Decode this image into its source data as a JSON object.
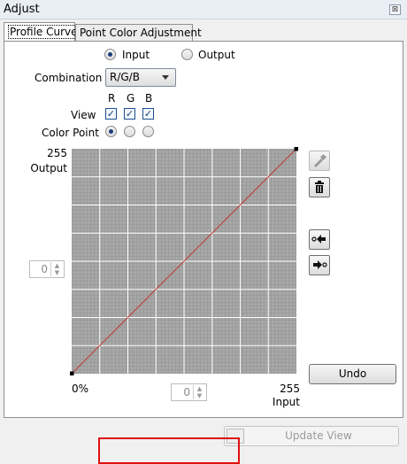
{
  "window": {
    "title": "Adjust",
    "close_glyph": "⊠"
  },
  "tabs": [
    {
      "label": "Profile Curve",
      "active": true
    },
    {
      "label": "Point Color Adjustment",
      "active": false
    }
  ],
  "mode": {
    "input_label": "Input",
    "output_label": "Output",
    "selected": "Input"
  },
  "combination": {
    "label": "Combination",
    "value": "R/G/B"
  },
  "channels": {
    "r": "R",
    "g": "G",
    "b": "B"
  },
  "view": {
    "label": "View",
    "r": true,
    "g": true,
    "b": true
  },
  "color_point": {
    "label": "Color Point",
    "selected": "R"
  },
  "curve": {
    "output_max": "255",
    "output_label": "Output",
    "input_min": "0%",
    "input_max": "255",
    "input_label": "Input",
    "points": [
      [
        0,
        0
      ],
      [
        255,
        255
      ]
    ],
    "line_color": "#c0392b",
    "grid_color": "#9b9b9b"
  },
  "output_spin": {
    "value": "0"
  },
  "input_spin": {
    "value": "0"
  },
  "tools": {
    "eyedropper": "eyedropper-icon",
    "delete": "trash-icon",
    "prev_point": "prev-point-icon",
    "next_point": "next-point-icon"
  },
  "buttons": {
    "undo": "Undo",
    "update_view": "Update View"
  },
  "colors": {
    "highlight_frame": "#e01010",
    "checkbox": "#1d3d7a"
  }
}
